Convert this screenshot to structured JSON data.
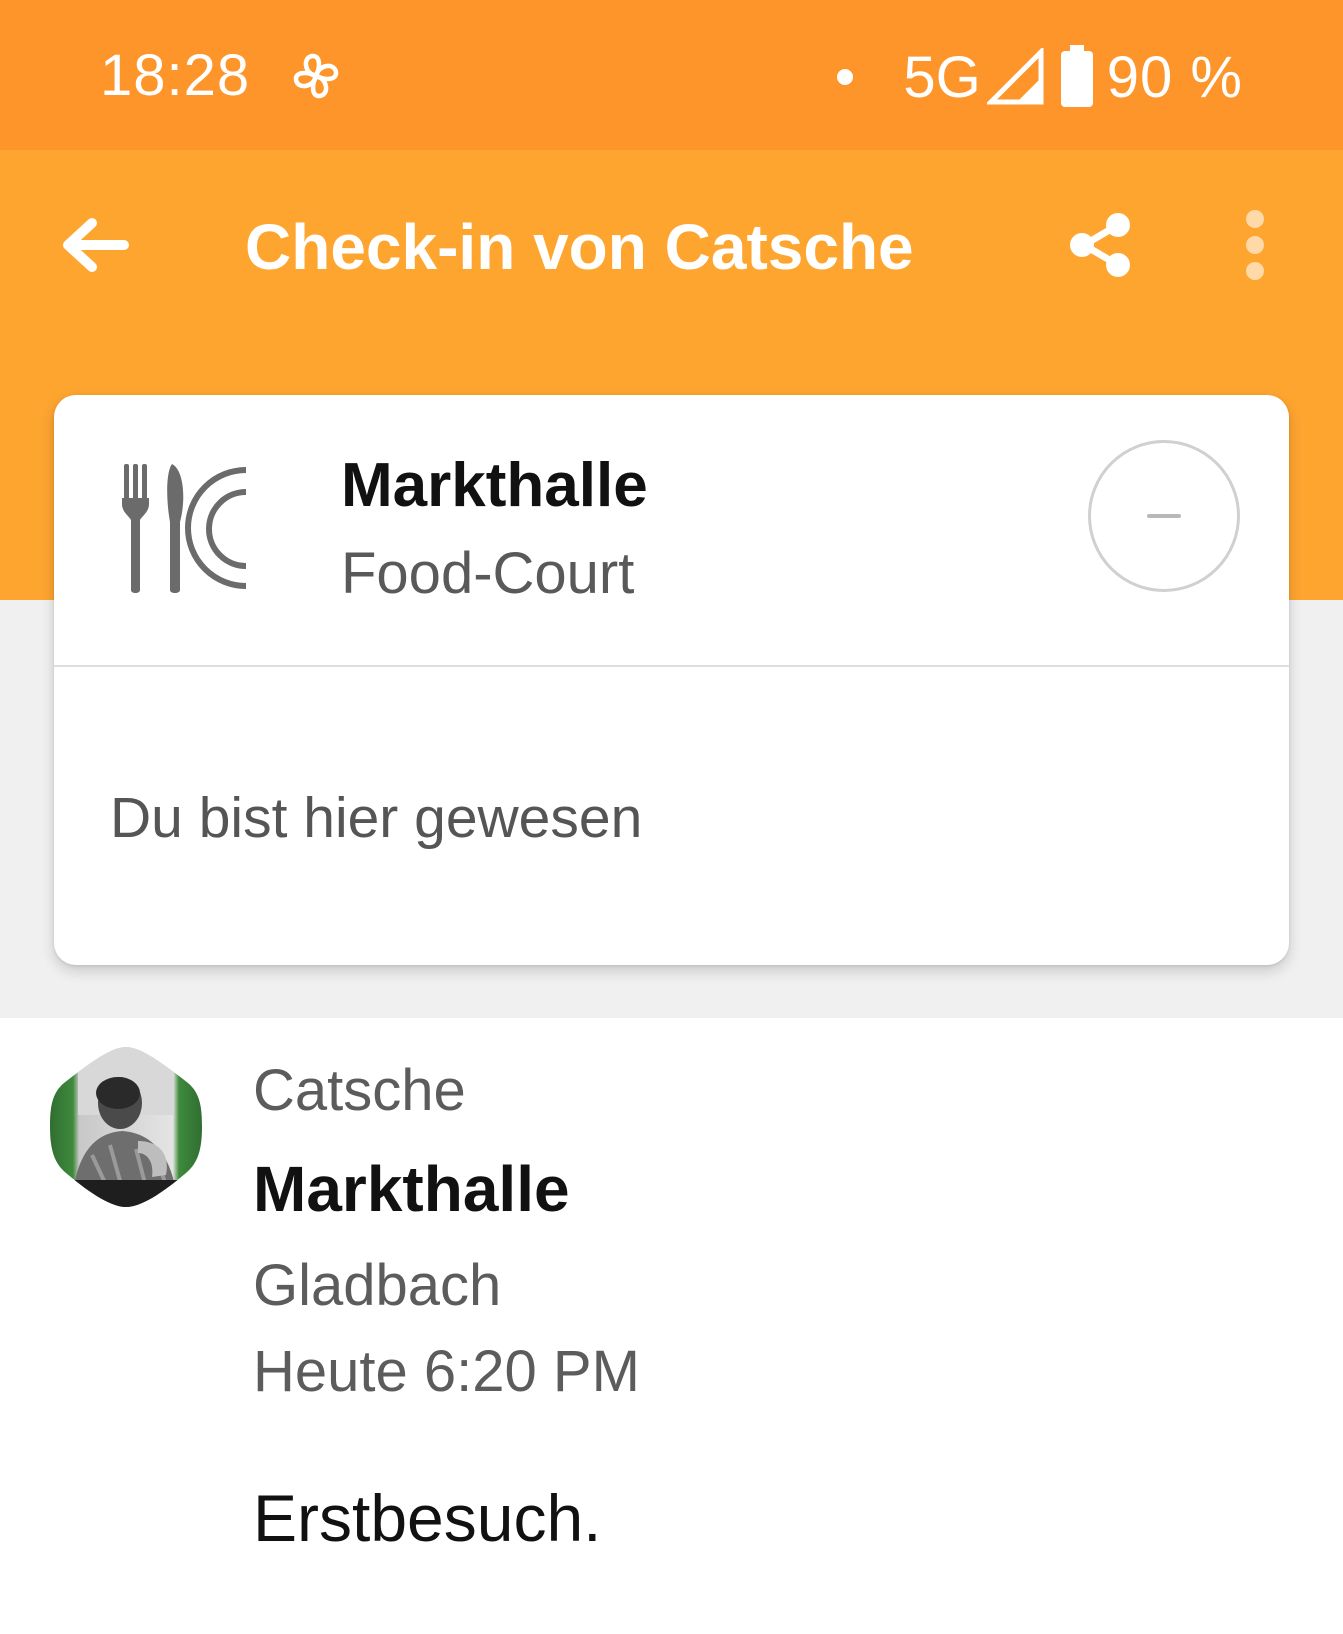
{
  "status_bar": {
    "time": "18:28",
    "network": "5G",
    "battery": "90 %",
    "icons": [
      "fan-icon",
      "notification-dot-icon",
      "signal-icon",
      "battery-icon"
    ]
  },
  "app_bar": {
    "title": "Check-in von Catsche",
    "icons": [
      "back-arrow-icon",
      "share-icon",
      "more-vert-icon"
    ]
  },
  "venue_card": {
    "name": "Markthalle",
    "category": "Food-Court",
    "icon": "food-court-icon",
    "visited_text": "Du bist hier gewesen"
  },
  "checkin": {
    "user": "Catsche",
    "venue": "Markthalle",
    "city": "Gladbach",
    "time": "Heute 6:20 PM",
    "shout": "Erstbesuch."
  },
  "colors": {
    "status_bar": "#fe952a",
    "app_bar": "#fea530",
    "background_band": "#f0f0f0"
  }
}
